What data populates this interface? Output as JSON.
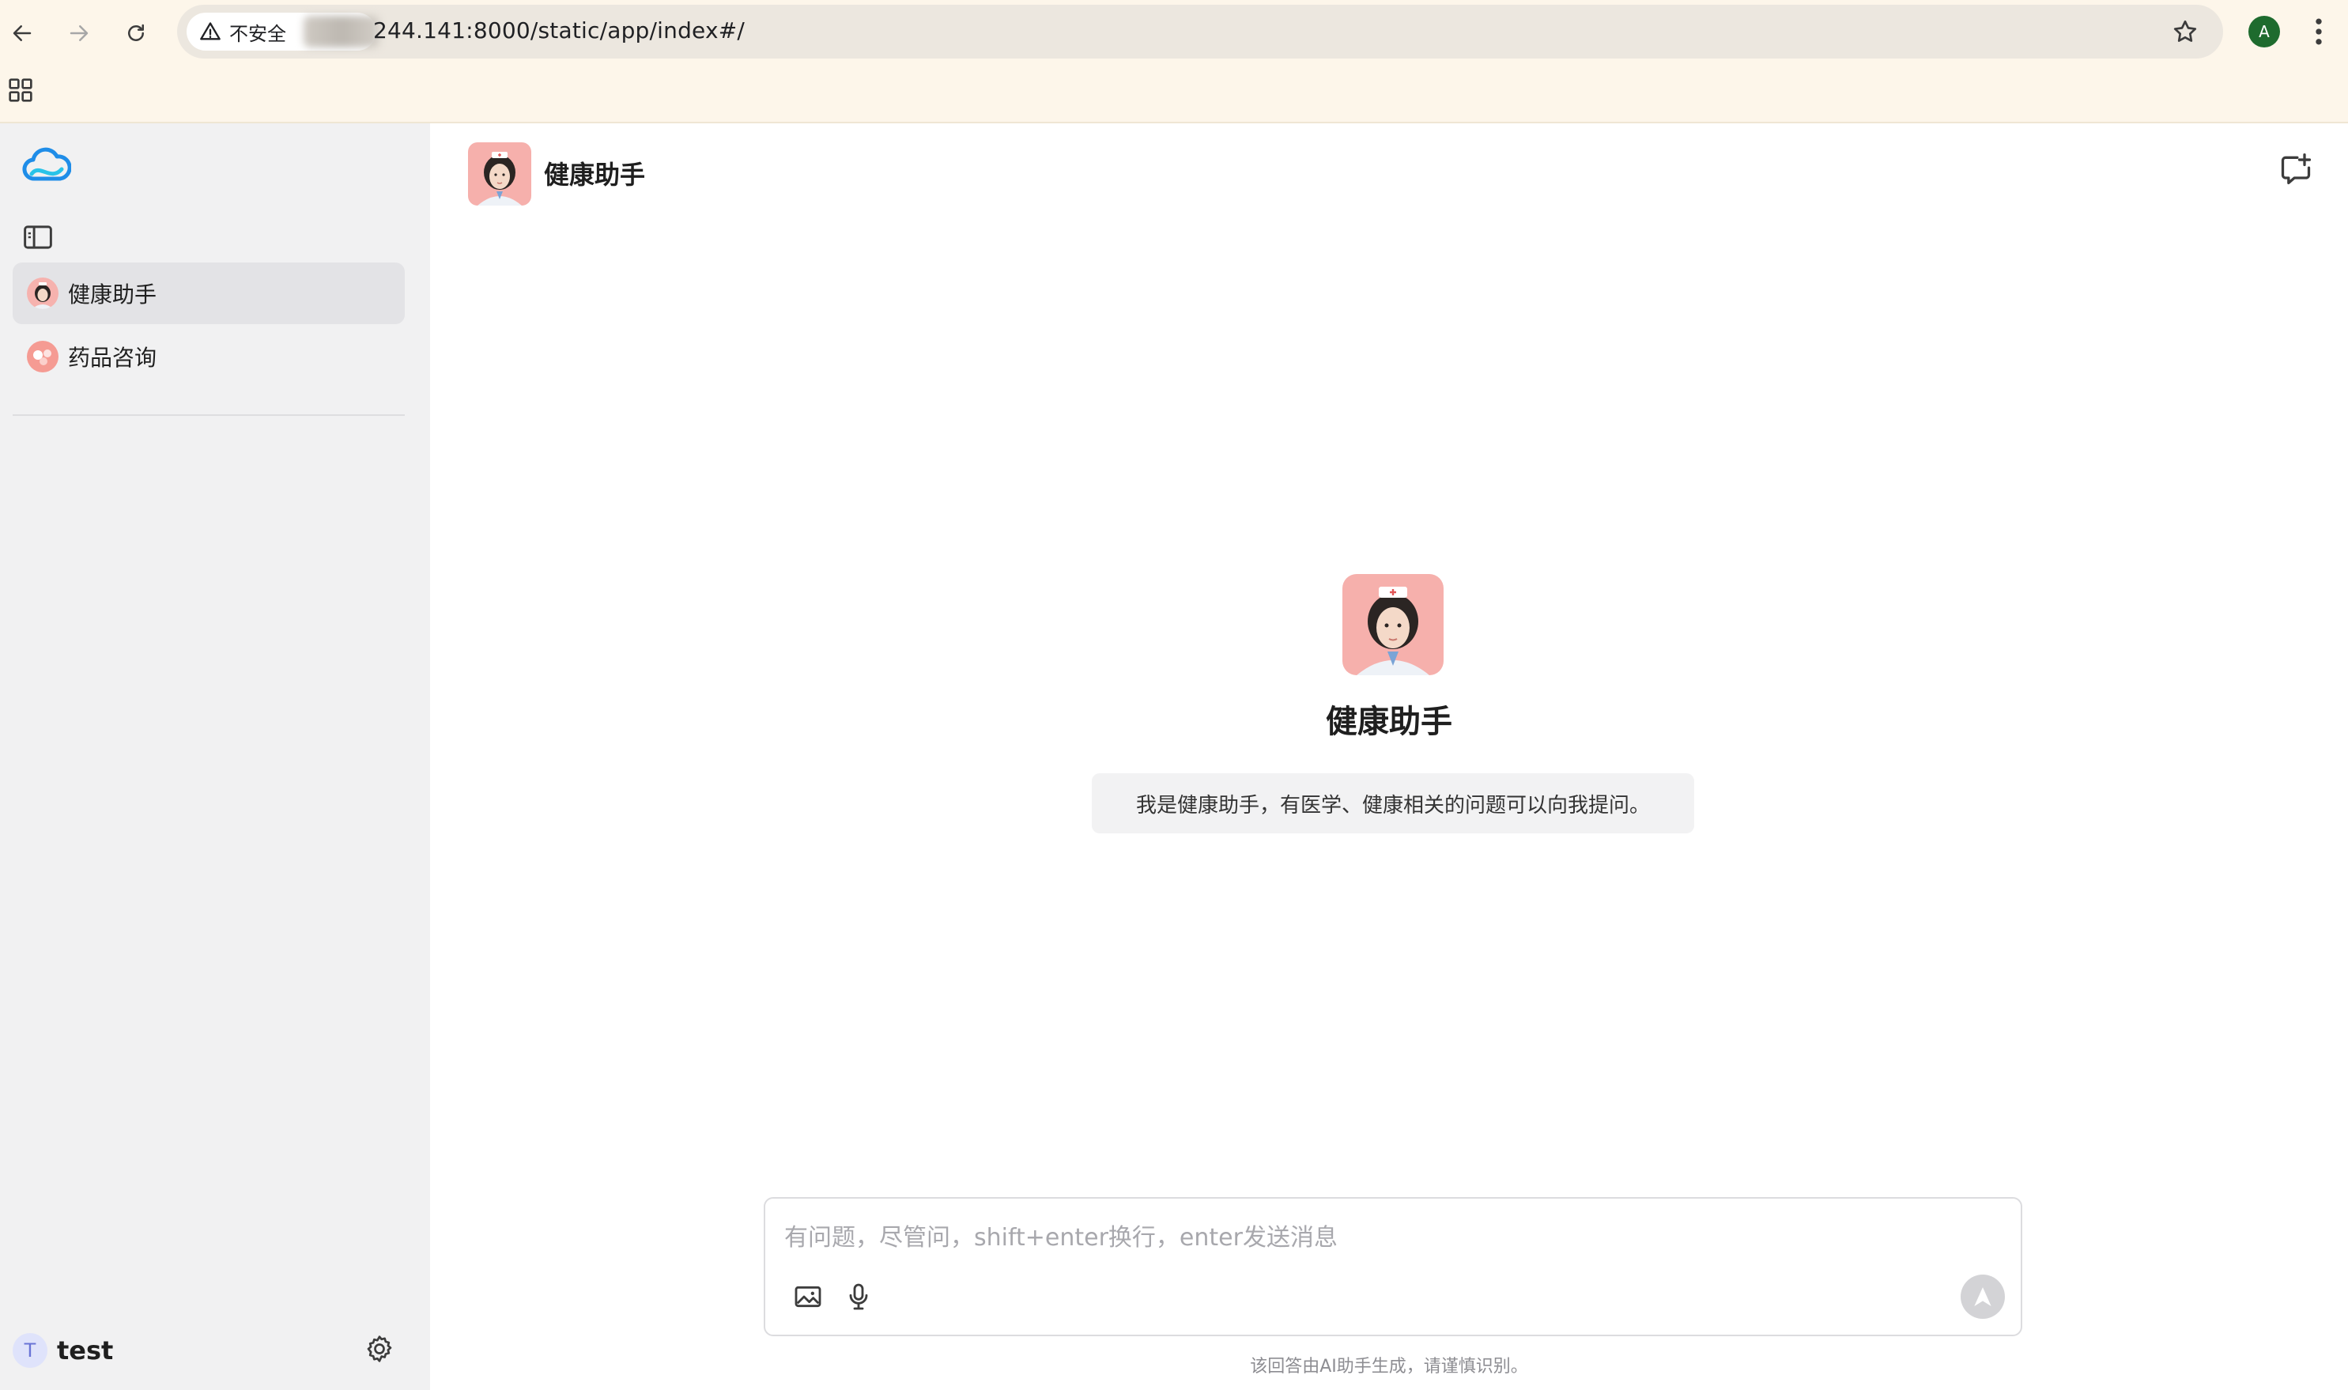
{
  "browser": {
    "security_label": "不安全",
    "url": "244.141:8000/static/app/index#/",
    "profile_initial": "A"
  },
  "sidebar": {
    "conversations": [
      {
        "label": "健康助手",
        "active": true
      },
      {
        "label": "药品咨询",
        "active": false
      }
    ],
    "user": {
      "initial": "T",
      "name": "test"
    }
  },
  "main": {
    "header_title": "健康助手",
    "welcome": {
      "title": "健康助手",
      "message": "我是健康助手，有医学、健康相关的问题可以向我提问。"
    },
    "composer": {
      "placeholder": "有问题，尽管问，shift+enter换行，enter发送消息"
    },
    "disclaimer": "该回答由AI助手生成，请谨慎识别。"
  },
  "colors": {
    "browser_bg": "#fdf6ea",
    "sidebar_bg": "#f1f1f2",
    "active_item_bg": "#e3e3e6",
    "logo_blue": "#1f8de8",
    "avatar_pink": "#f5a3a3",
    "profile_green": "#1e6b2e"
  },
  "icons": {
    "back": "arrow-left-icon",
    "forward": "arrow-right-icon",
    "reload": "reload-icon",
    "warning": "warning-triangle-icon",
    "star": "star-icon",
    "menu": "kebab-menu-icon",
    "apps": "apps-grid-icon",
    "logo": "cloud-logo-icon",
    "sidebar_toggle": "sidebar-toggle-icon",
    "new_chat": "new-chat-icon",
    "image": "image-icon",
    "mic": "microphone-icon",
    "send": "send-icon",
    "settings": "gear-icon"
  }
}
